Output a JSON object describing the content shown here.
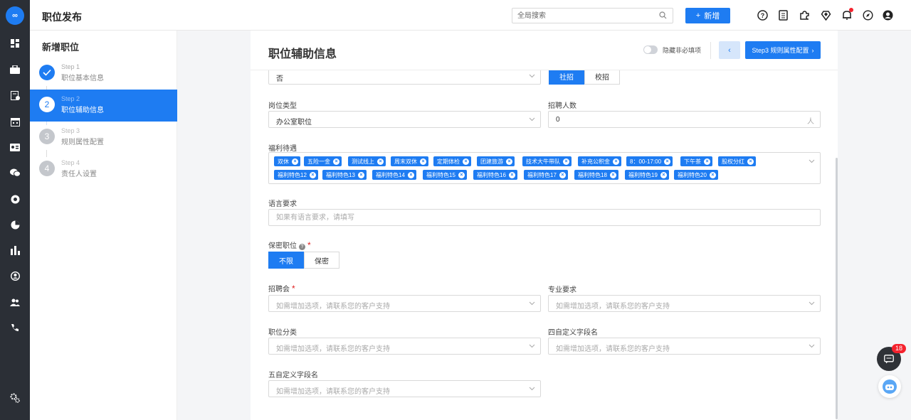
{
  "header": {
    "title": "职位发布",
    "search_placeholder": "全局搜索",
    "add_label": "新增"
  },
  "steps": {
    "title": "新增职位",
    "items": [
      {
        "index": "1",
        "step": "Step 1",
        "label": "职位基本信息",
        "state": "done"
      },
      {
        "index": "2",
        "step": "Step 2",
        "label": "职位辅助信息",
        "state": "active"
      },
      {
        "index": "3",
        "step": "Step 3",
        "label": "规则属性配置",
        "state": "pending"
      },
      {
        "index": "4",
        "step": "Step 4",
        "label": "责任人设置",
        "state": "pending"
      }
    ]
  },
  "main": {
    "title": "职位辅助信息",
    "toggle_label": "隐藏非必填项",
    "next_label": "Step3 规则属性配置",
    "top_select_value": "否",
    "recruit_types": [
      "社招",
      "校招"
    ],
    "position_type_label": "岗位类型",
    "position_type_value": "办公室职位",
    "headcount_label": "招聘人数",
    "headcount_value": "0",
    "headcount_unit": "人",
    "benefits_label": "福利待遇",
    "benefits": [
      "双休",
      "五险一金",
      "测试线上",
      "周末双休",
      "定期体检",
      "团建旅游",
      "技术大牛带队",
      "补充公积金",
      "8：00-17:00",
      "下午茶",
      "股权分红",
      "福利特色12",
      "福利特色13",
      "福利特色14",
      "福利特色15",
      "福利特色16",
      "福利特色17",
      "福利特色18",
      "福利特色19",
      "福利特色20"
    ],
    "language_label": "语言要求",
    "language_placeholder": "如果有语言要求，请填写",
    "confidential_label": "保密职位",
    "confidential_options": [
      "不限",
      "保密"
    ],
    "job_fair_label": "招聘会",
    "major_label": "专业要求",
    "category_label": "职位分类",
    "custom4_label": "四自定义字段名",
    "custom5_label": "五自定义字段名",
    "select_placeholder": "如需增加选项，请联系您的客户支持"
  },
  "chat_badge": "18"
}
